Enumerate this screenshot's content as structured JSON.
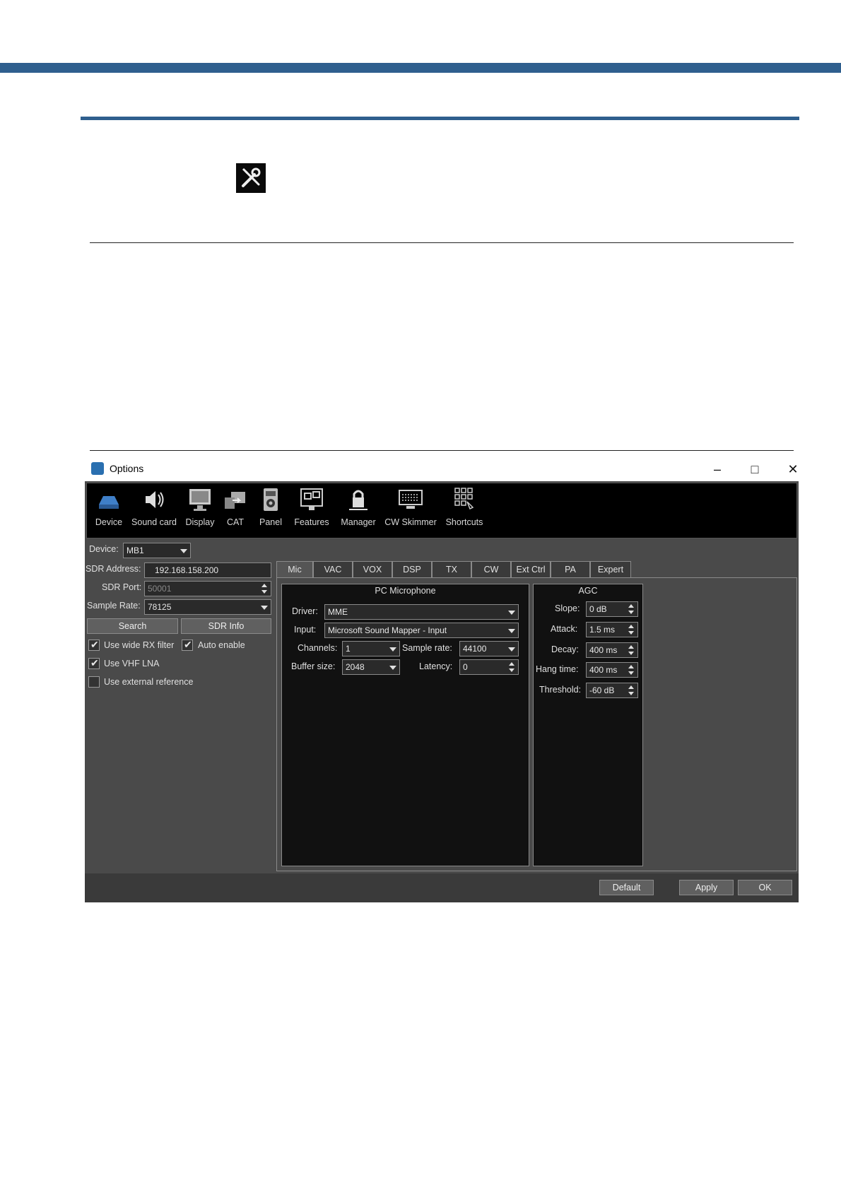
{
  "window": {
    "title": "Options",
    "min": "–",
    "max": "□",
    "close": "✕"
  },
  "toolbar": [
    "Device",
    "Sound card",
    "Display",
    "CAT",
    "Panel",
    "Features",
    "Manager",
    "CW Skimmer",
    "Shortcuts"
  ],
  "left": {
    "device_label": "Device:",
    "device_value": "MB1",
    "sdr_address_label": "SDR Address:",
    "sdr_address_value": "192.168.158.200",
    "sdr_port_label": "SDR Port:",
    "sdr_port_value": "50001",
    "sample_rate_label": "Sample Rate:",
    "sample_rate_value": "78125",
    "search_btn": "Search",
    "sdr_info_btn": "SDR Info",
    "wide_rx": "Use wide RX filter",
    "auto_enable": "Auto enable",
    "vhf_lna": "Use VHF LNA",
    "ext_ref": "Use external reference"
  },
  "tabs": [
    "Mic",
    "VAC",
    "VOX",
    "DSP",
    "TX",
    "CW",
    "Ext Ctrl",
    "PA",
    "Expert"
  ],
  "mic": {
    "title": "PC Microphone",
    "driver_label": "Driver:",
    "driver_value": "MME",
    "input_label": "Input:",
    "input_value": "Microsoft Sound Mapper - Input",
    "channels_label": "Channels:",
    "channels_value": "1",
    "sample_rate_label": "Sample rate:",
    "sample_rate_value": "44100",
    "buffer_label": "Buffer size:",
    "buffer_value": "2048",
    "latency_label": "Latency:",
    "latency_value": "0"
  },
  "agc": {
    "title": "AGC",
    "slope_label": "Slope:",
    "slope_value": "0 dB",
    "attack_label": "Attack:",
    "attack_value": "1.5 ms",
    "decay_label": "Decay:",
    "decay_value": "400 ms",
    "hang_label": "Hang time:",
    "hang_value": "400 ms",
    "threshold_label": "Threshold:",
    "threshold_value": "-60 dB"
  },
  "footer": {
    "default_btn": "Default",
    "apply_btn": "Apply",
    "ok_btn": "OK"
  }
}
